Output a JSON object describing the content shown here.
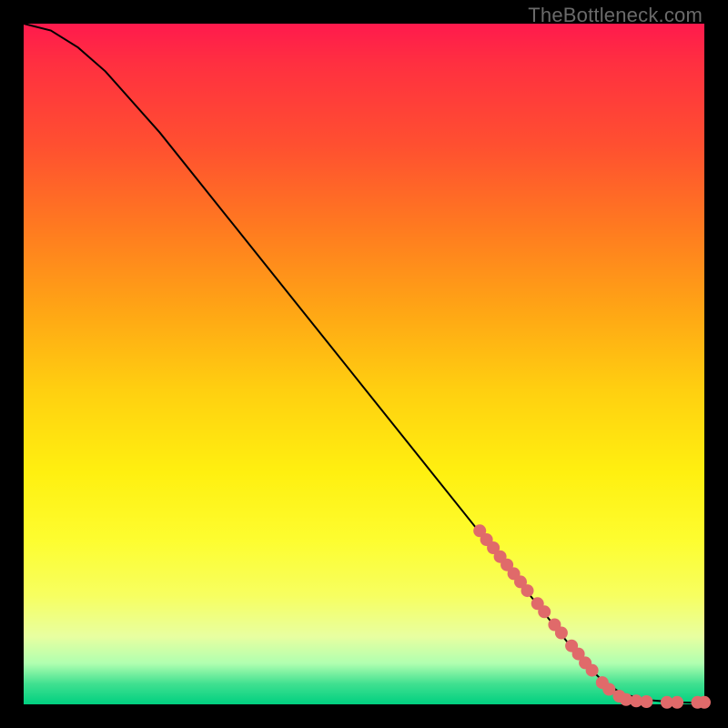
{
  "watermark": "TheBottleneck.com",
  "chart_data": {
    "type": "line",
    "title": "",
    "xlabel": "",
    "ylabel": "",
    "xlim": [
      0,
      100
    ],
    "ylim": [
      0,
      100
    ],
    "curve": {
      "x": [
        0,
        4,
        8,
        12,
        20,
        30,
        40,
        50,
        60,
        70,
        76,
        80,
        83,
        85,
        88,
        92,
        96,
        100
      ],
      "y": [
        100,
        99,
        96.5,
        93,
        84,
        71.5,
        59,
        46.5,
        34,
        21.5,
        14,
        9,
        5.5,
        3.5,
        1.5,
        0.6,
        0.3,
        0.2
      ]
    },
    "markers": {
      "color": "#e06a6a",
      "radius_px": 7,
      "points": [
        {
          "x": 67.0,
          "y": 25.5
        },
        {
          "x": 68.0,
          "y": 24.2
        },
        {
          "x": 69.0,
          "y": 23.0
        },
        {
          "x": 70.0,
          "y": 21.7
        },
        {
          "x": 71.0,
          "y": 20.5
        },
        {
          "x": 72.0,
          "y": 19.2
        },
        {
          "x": 73.0,
          "y": 18.0
        },
        {
          "x": 74.0,
          "y": 16.7
        },
        {
          "x": 75.5,
          "y": 14.8
        },
        {
          "x": 76.5,
          "y": 13.6
        },
        {
          "x": 78.0,
          "y": 11.7
        },
        {
          "x": 79.0,
          "y": 10.5
        },
        {
          "x": 80.5,
          "y": 8.6
        },
        {
          "x": 81.5,
          "y": 7.4
        },
        {
          "x": 82.5,
          "y": 6.1
        },
        {
          "x": 83.5,
          "y": 5.0
        },
        {
          "x": 85.0,
          "y": 3.2
        },
        {
          "x": 86.0,
          "y": 2.2
        },
        {
          "x": 87.5,
          "y": 1.2
        },
        {
          "x": 88.5,
          "y": 0.7
        },
        {
          "x": 90.0,
          "y": 0.5
        },
        {
          "x": 91.5,
          "y": 0.4
        },
        {
          "x": 94.5,
          "y": 0.3
        },
        {
          "x": 96.0,
          "y": 0.3
        },
        {
          "x": 99.0,
          "y": 0.3
        },
        {
          "x": 100.0,
          "y": 0.3
        }
      ]
    }
  }
}
